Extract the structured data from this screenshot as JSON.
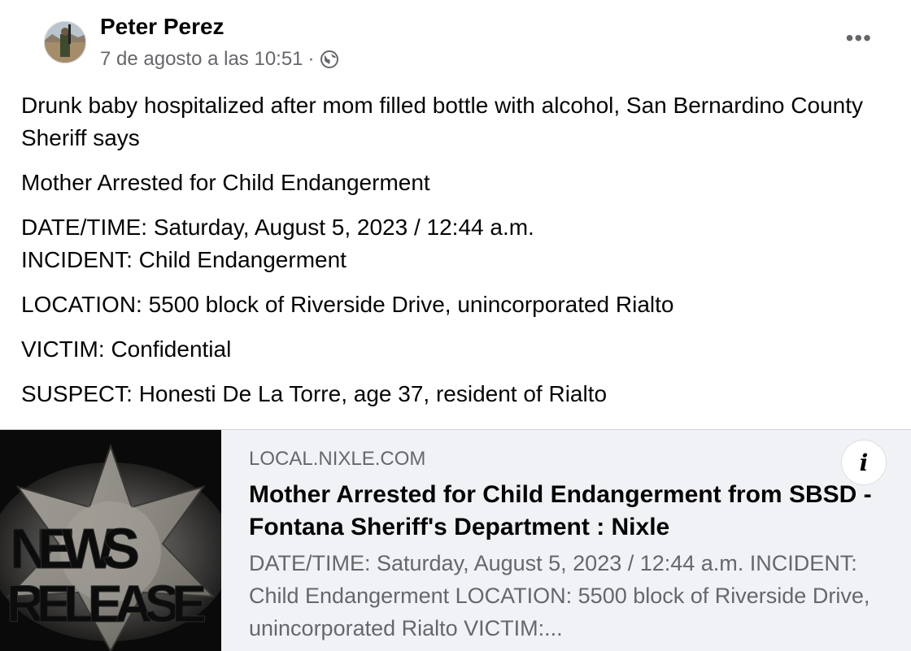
{
  "post": {
    "author": "Peter Perez",
    "timestamp": "7 de agosto a las 10:51",
    "separator": "·",
    "audience_icon": "globe-icon",
    "more_options_label": "•••",
    "paragraphs": [
      [
        "Drunk baby hospitalized after mom filled bottle with alcohol, San Bernardino County Sheriff says"
      ],
      [
        "Mother Arrested for Child Endangerment"
      ],
      [
        "DATE/TIME: Saturday, August 5, 2023 / 12:44 a.m.",
        "INCIDENT: Child Endangerment"
      ],
      [
        "LOCATION: 5500 block of Riverside Drive, unincorporated Rialto"
      ],
      [
        "VICTIM: Confidential"
      ],
      [
        "SUSPECT: Honesti De La Torre, age 37, resident of Rialto"
      ]
    ]
  },
  "link_preview": {
    "domain": "LOCAL.NIXLE.COM",
    "title": "Mother Arrested for Child Endangerment from SBSD - Fontana Sheriff's Department : Nixle",
    "description": "DATE/TIME: Saturday, August 5, 2023 / 12:44 a.m. INCIDENT: Child Endangerment LOCATION: 5500 block of Riverside Drive, unincorporated Rialto VICTIM:...",
    "thumbnail": {
      "line1": "NEWS",
      "line2": "RELEASE"
    },
    "info_label": "i"
  },
  "colors": {
    "text_primary": "#050505",
    "text_secondary": "#65676b",
    "card_background": "#f0f2f5"
  }
}
